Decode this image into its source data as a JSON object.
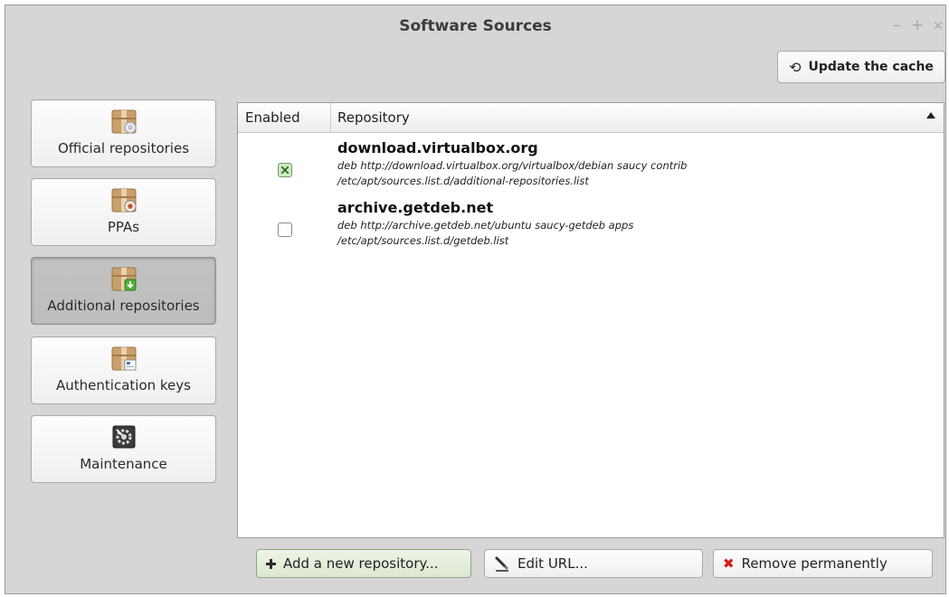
{
  "window": {
    "title": "Software Sources",
    "controls": {
      "minimize": "–",
      "maximize": "+",
      "close": "×"
    }
  },
  "toolbar": {
    "update_cache_label": "Update the cache",
    "update_cache_icon": "refresh-icon"
  },
  "sidebar": {
    "items": [
      {
        "label": "Official repositories",
        "icon": "package-cd-icon",
        "active": false
      },
      {
        "label": "PPAs",
        "icon": "package-ppa-icon",
        "active": false
      },
      {
        "label": "Additional repositories",
        "icon": "package-download-icon",
        "active": true
      },
      {
        "label": "Authentication keys",
        "icon": "package-key-icon",
        "active": false
      },
      {
        "label": "Maintenance",
        "icon": "maintenance-gear-icon",
        "active": false
      }
    ]
  },
  "table": {
    "columns": {
      "enabled": "Enabled",
      "repository": "Repository"
    },
    "sort": "ascending",
    "rows": [
      {
        "enabled": true,
        "name": "download.virtualbox.org",
        "line": "deb http://download.virtualbox.org/virtualbox/debian saucy contrib",
        "file": "/etc/apt/sources.list.d/additional-repositories.list"
      },
      {
        "enabled": false,
        "name": "archive.getdeb.net",
        "line": "deb http://archive.getdeb.net/ubuntu saucy-getdeb apps",
        "file": "/etc/apt/sources.list.d/getdeb.list"
      }
    ]
  },
  "actions": {
    "add_label": "Add a new repository...",
    "edit_label": "Edit URL...",
    "remove_label": "Remove permanently"
  },
  "colors": {
    "window_bg": "#d6d6d6",
    "active_nav_bg": "#bdbdbd",
    "checkbox_checked": "#cde7c5",
    "remove_icon": "#d31b1b",
    "package_box": "#c9a06c"
  }
}
